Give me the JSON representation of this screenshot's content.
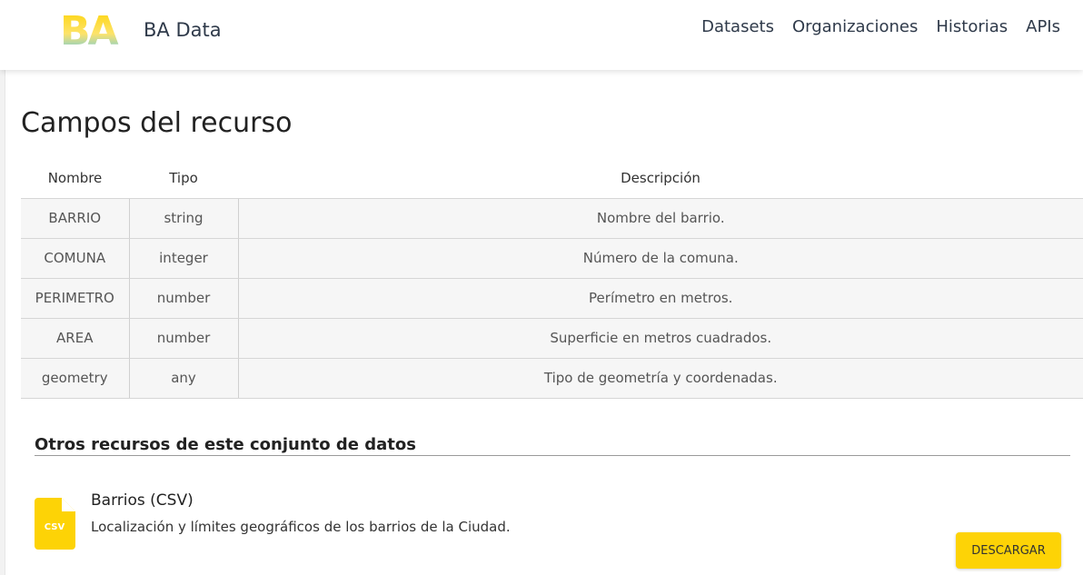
{
  "header": {
    "logo_text": "BA",
    "brand": "BA Data",
    "nav": [
      {
        "label": "Datasets"
      },
      {
        "label": "Organizaciones"
      },
      {
        "label": "Historias"
      },
      {
        "label": "APIs"
      }
    ]
  },
  "fields": {
    "title": "Campos del recurso",
    "columns": [
      "Nombre",
      "Tipo",
      "Descripción"
    ],
    "rows": [
      {
        "name": "BARRIO",
        "type": "string",
        "desc": "Nombre del barrio."
      },
      {
        "name": "COMUNA",
        "type": "integer",
        "desc": "Número de la comuna."
      },
      {
        "name": "PERIMETRO",
        "type": "number",
        "desc": "Perímetro en metros."
      },
      {
        "name": "AREA",
        "type": "number",
        "desc": "Superficie en metros cuadrados."
      },
      {
        "name": "geometry",
        "type": "any",
        "desc": "Tipo de geometría y coordenadas."
      }
    ]
  },
  "other_resources": {
    "title": "Otros recursos de este conjunto de datos",
    "items": [
      {
        "format": "CSV",
        "title": "Barrios (CSV)",
        "description": "Localización y límites geográficos de los barrios de la Ciudad.",
        "button": "DESCARGAR"
      }
    ]
  },
  "colors": {
    "accent_yellow": "#fdd306",
    "logo_blue": "#5bc8f0",
    "nav_text": "#2f3a4a"
  }
}
